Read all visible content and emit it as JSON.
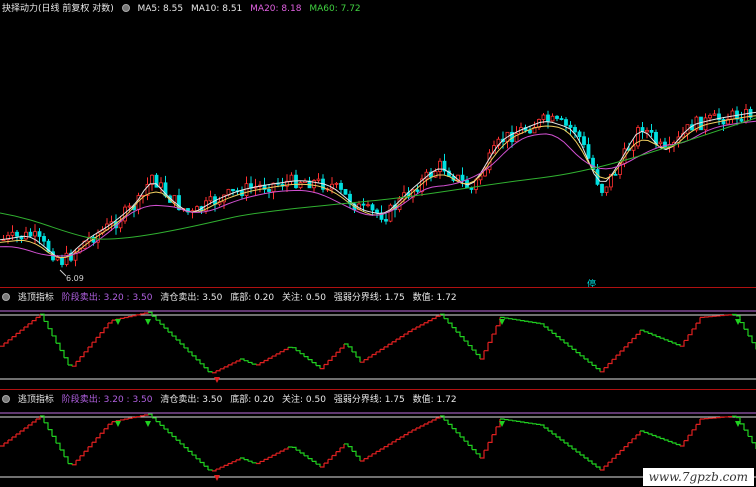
{
  "main": {
    "title": "抉择动力(日线 前复权 对数)",
    "ma": [
      {
        "label": "MA5: 8.55",
        "color": "#e8e8e8"
      },
      {
        "label": "MA10: 8.51",
        "color": "#e8e8e8"
      },
      {
        "label": "MA20: 8.18",
        "color": "#e060e0"
      },
      {
        "label": "MA60: 7.72",
        "color": "#40d040"
      }
    ],
    "low_label": "6.09",
    "badge": "停"
  },
  "indicator1": {
    "name": "逃顶指标",
    "items": [
      {
        "label": "阶段卖出: 3.20 : 3.50",
        "color": "#b060e0"
      },
      {
        "label": "清仓卖出: 3.50",
        "color": "#e8e8e8"
      },
      {
        "label": "底部: 0.20",
        "color": "#e8e8e8"
      },
      {
        "label": "关注: 0.50",
        "color": "#e8e8e8"
      },
      {
        "label": "强弱分界线: 1.75",
        "color": "#e8e8e8"
      },
      {
        "label": "数值: 1.72",
        "color": "#e8e8e8"
      }
    ]
  },
  "indicator2": {
    "name": "逃顶指标",
    "items": [
      {
        "label": "阶段卖出: 3.20 : 3.50",
        "color": "#b060e0"
      },
      {
        "label": "清仓卖出: 3.50",
        "color": "#e8e8e8"
      },
      {
        "label": "底部: 0.20",
        "color": "#e8e8e8"
      },
      {
        "label": "关注: 0.50",
        "color": "#e8e8e8"
      },
      {
        "label": "强弱分界线: 1.75",
        "color": "#e8e8e8"
      },
      {
        "label": "数值: 1.72",
        "color": "#e8e8e8"
      }
    ]
  },
  "watermark": "www.7gpzb.com",
  "colors": {
    "up": "#ff3030",
    "down": "#00e0e0",
    "ind_up": "#e02020",
    "ind_down": "#20d020"
  }
}
